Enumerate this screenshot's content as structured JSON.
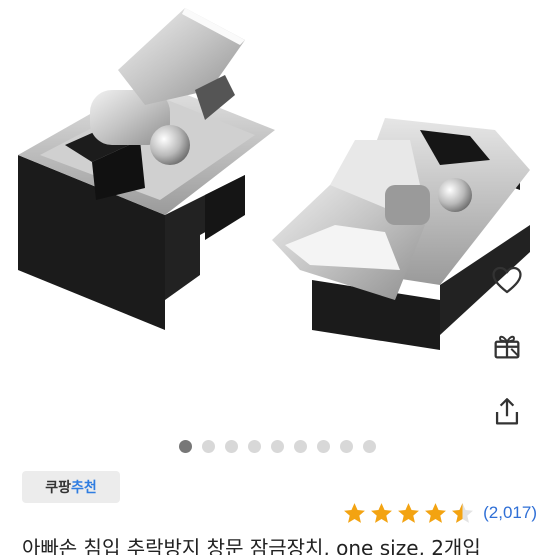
{
  "product": {
    "title": "아빠손 침입 추락방지 창문 잠금장치, one size, 2개입",
    "image_alt": "product photo: two window lock latches"
  },
  "side_actions": [
    {
      "icon": "heart-icon"
    },
    {
      "icon": "gift-icon"
    },
    {
      "icon": "share-icon"
    }
  ],
  "carousel": {
    "total": 9,
    "active": 1
  },
  "badge": {
    "part1": "쿠팡",
    "part2": "추천"
  },
  "rating": {
    "stars": 4.5,
    "count": "(2,017)",
    "star_color": "#f3a311"
  },
  "colors": {
    "link_blue": "#2f6fd6",
    "badge_blue": "#2f7de1"
  }
}
